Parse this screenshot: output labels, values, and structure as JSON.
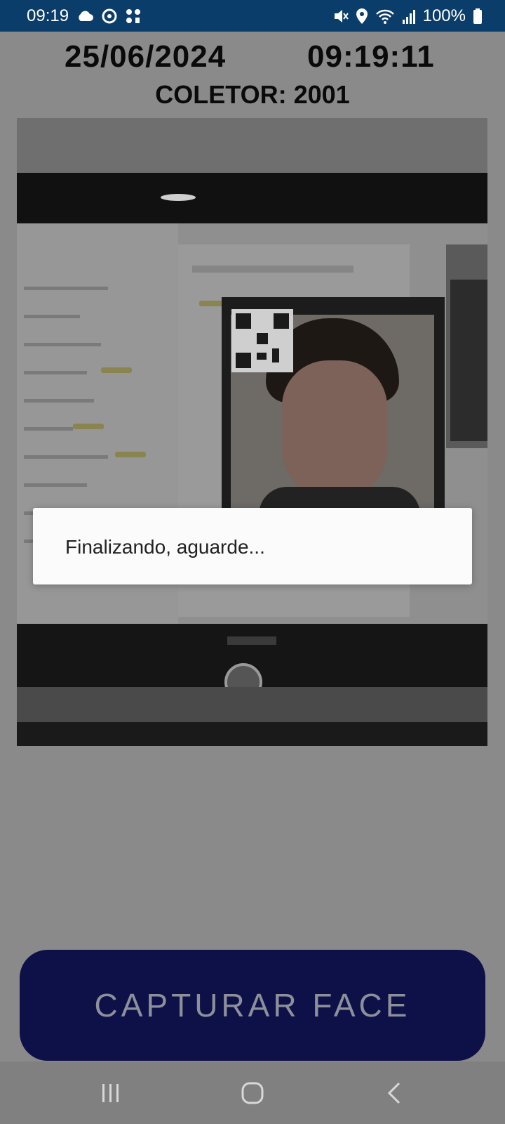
{
  "status_bar": {
    "time": "09:19",
    "battery": "100%",
    "left_icons": [
      "cloud-icon",
      "sync-icon",
      "app-icon"
    ],
    "right_icons": [
      "mute-icon",
      "location-icon",
      "wifi-icon",
      "signal-icon",
      "battery-icon"
    ]
  },
  "header": {
    "date": "25/06/2024",
    "time": "09:19:11",
    "collector": "COLETOR: 2001"
  },
  "dialog": {
    "message": "Finalizando, aguarde..."
  },
  "capture_button": {
    "label": "CAPTURAR FACE"
  },
  "nav_bar": {
    "buttons": [
      "recents-icon",
      "home-icon",
      "back-icon"
    ]
  },
  "colors": {
    "status_bar": "#0b3d6b",
    "button_bg": "#0e1148",
    "overlay": "#8a8a8a"
  }
}
